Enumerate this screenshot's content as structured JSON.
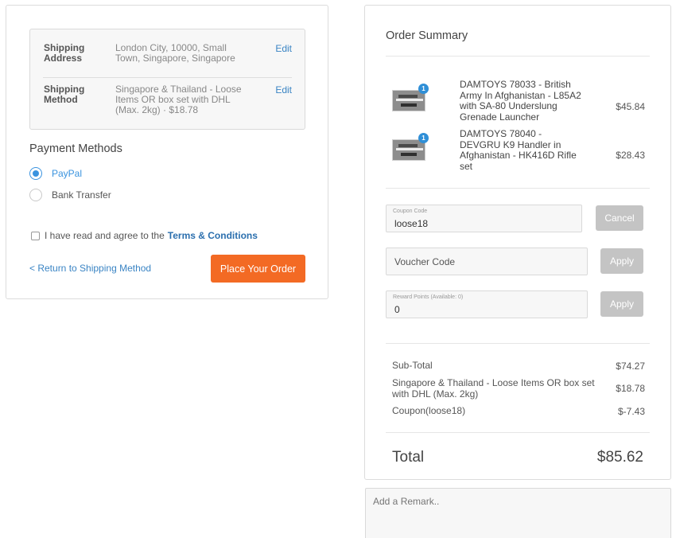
{
  "shipping": {
    "address_label": "Shipping Address",
    "address_value": "London City, 10000, Small Town, Singapore, Singapore",
    "method_label": "Shipping Method",
    "method_value": "Singapore & Thailand - Loose Items OR box set with DHL (Max. 2kg) · $18.78",
    "edit_label": "Edit"
  },
  "payment": {
    "title": "Payment Methods",
    "options": [
      {
        "label": "PayPal",
        "selected": true
      },
      {
        "label": "Bank Transfer",
        "selected": false
      }
    ]
  },
  "terms": {
    "text": "I have read and agree to the",
    "link": "Terms & Conditions"
  },
  "actions": {
    "back_label": "< Return to Shipping Method",
    "place_order_label": "Place Your Order"
  },
  "summary": {
    "title": "Order Summary",
    "items": [
      {
        "name": "DAMTOYS 78033 - British Army In Afghanistan - L85A2 with SA-80 Underslung Grenade Launcher",
        "qty": "1",
        "price": "$45.84"
      },
      {
        "name": "DAMTOYS 78040 - DEVGRU K9 Handler in Afghanistan - HK416D Rifle set",
        "qty": "1",
        "price": "$28.43"
      }
    ],
    "coupon": {
      "label": "Coupon Code",
      "value": "loose18",
      "button": "Cancel"
    },
    "voucher": {
      "placeholder": "Voucher Code",
      "button": "Apply"
    },
    "reward": {
      "label": "Reward Points (Available: 0)",
      "value": "0",
      "button": "Apply"
    },
    "totals": [
      {
        "label": "Sub-Total",
        "value": "$74.27"
      },
      {
        "label": "Singapore & Thailand - Loose Items OR box set with DHL (Max. 2kg)",
        "value": "$18.78"
      },
      {
        "label": "Coupon(loose18)",
        "value": "$-7.43"
      }
    ],
    "total_label": "Total",
    "total_value": "$85.62"
  },
  "remark": {
    "placeholder": "Add a Remark.."
  },
  "colors": {
    "accent": "#f36a24",
    "link": "#3a84c4",
    "radio": "#3a93df",
    "badge": "#2f8fd7"
  }
}
